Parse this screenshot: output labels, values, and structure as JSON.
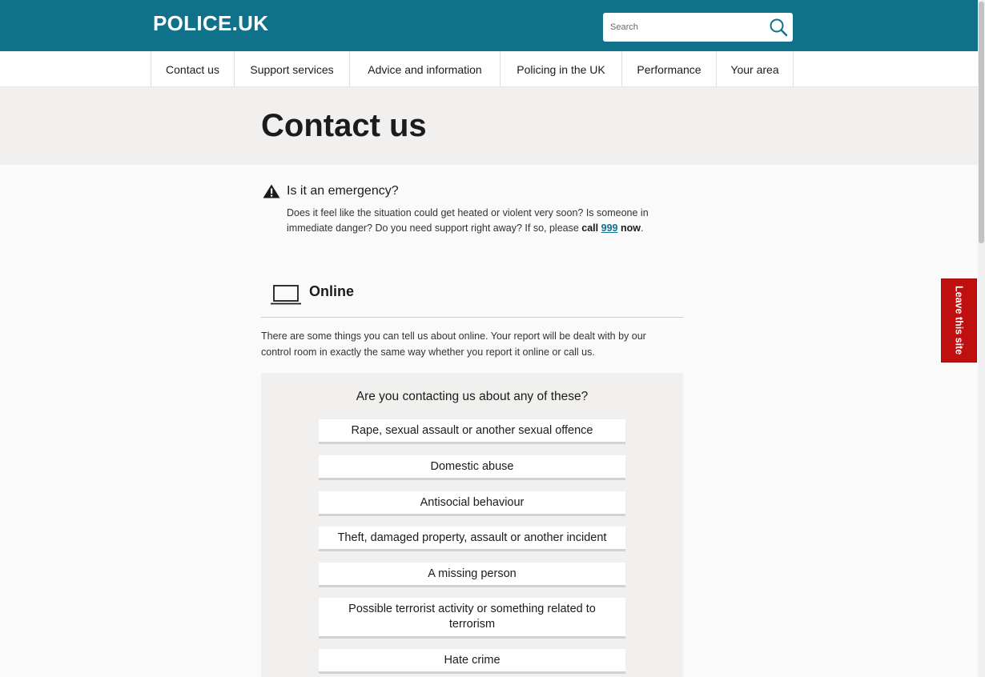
{
  "header": {
    "logo": "POLICE.UK",
    "search_placeholder": "Search",
    "search_icon": "search-icon"
  },
  "nav": {
    "items": [
      {
        "label": "Contact us"
      },
      {
        "label": "Support services"
      },
      {
        "label": "Advice and information"
      },
      {
        "label": "Policing in the UK"
      },
      {
        "label": "Performance"
      },
      {
        "label": "Your area"
      }
    ]
  },
  "page": {
    "title": "Contact us"
  },
  "emergency": {
    "icon": "warning-icon",
    "heading": "Is it an emergency?",
    "text_before": "Does it feel like the situation could get heated or violent very soon? Is someone in immediate danger? Do you need support right away? If so, please ",
    "call": "call",
    "number": "999",
    "now": "now",
    "period": "."
  },
  "online": {
    "icon": "laptop-icon",
    "title": "Online",
    "description": "There are some things you can tell us about online. Your report will be dealt with by our control room in exactly the same way whether you report it online or call us."
  },
  "options": {
    "question": "Are you contacting us about any of these?",
    "items": [
      {
        "label": "Rape, sexual assault or another sexual offence"
      },
      {
        "label": "Domestic abuse"
      },
      {
        "label": "Antisocial behaviour"
      },
      {
        "label": "Theft, damaged property, assault or another incident"
      },
      {
        "label": "A missing person"
      },
      {
        "label": "Possible terrorist activity or something related to terrorism"
      },
      {
        "label": "Hate crime"
      }
    ]
  },
  "leave_site": {
    "label": "Leave this site",
    "color": "#c00f0f"
  },
  "colors": {
    "brand": "#10718b",
    "title_band": "#f1f0ee",
    "leave": "#c00f0f"
  }
}
